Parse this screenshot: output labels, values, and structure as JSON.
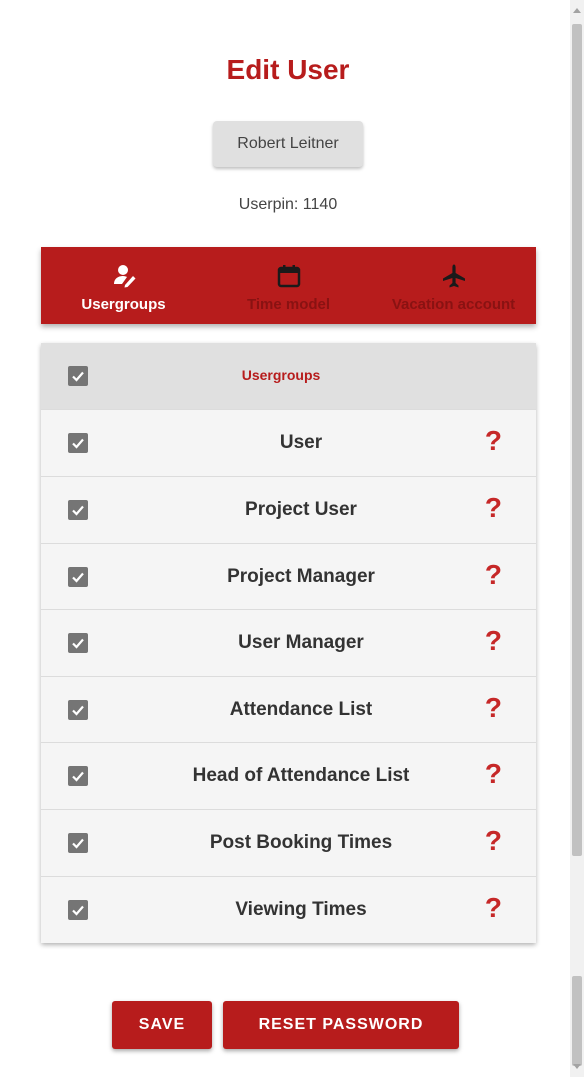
{
  "page": {
    "title": "Edit User"
  },
  "user": {
    "name": "Robert Leitner",
    "userpin": "Userpin: 1140"
  },
  "tabs": [
    {
      "label": "Usergroups",
      "icon": "user-edit-icon",
      "active": true
    },
    {
      "label": "Time model",
      "icon": "calendar-icon",
      "active": false
    },
    {
      "label": "Vacation account",
      "icon": "airplane-icon",
      "active": false
    }
  ],
  "table": {
    "header": "Usergroups",
    "rows": [
      {
        "label": "User",
        "checked": true
      },
      {
        "label": "Project User",
        "checked": true
      },
      {
        "label": "Project Manager",
        "checked": true
      },
      {
        "label": "User Manager",
        "checked": true
      },
      {
        "label": "Attendance List",
        "checked": true
      },
      {
        "label": "Head of Attendance List",
        "checked": true
      },
      {
        "label": "Post Booking Times",
        "checked": true
      },
      {
        "label": "Viewing Times",
        "checked": true
      }
    ],
    "help_glyph": "?"
  },
  "actions": {
    "save": "SAVE",
    "reset_password": "RESET PASSWORD"
  },
  "colors": {
    "accent": "#b71c1c",
    "checkbox": "#757575",
    "help": "#c62828"
  }
}
